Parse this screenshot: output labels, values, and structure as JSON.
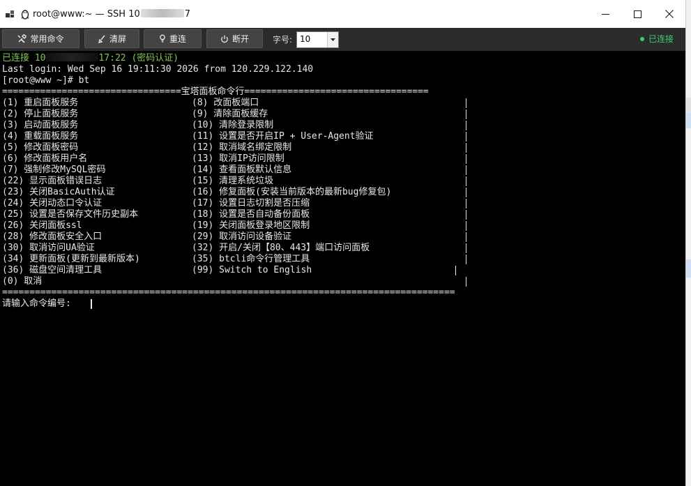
{
  "window": {
    "title_prefix": "root@www:~ — SSH 10",
    "title_suffix": "7",
    "minimize_glyph": "—",
    "maximize_glyph": "☐",
    "close_glyph": "✕"
  },
  "toolbar": {
    "buttons": [
      {
        "label": "常用命令",
        "icon": "tools-icon"
      },
      {
        "label": "清屏",
        "icon": "broom-icon"
      },
      {
        "label": "重连",
        "icon": "bulb-icon"
      },
      {
        "label": "断开",
        "icon": "power-icon"
      }
    ],
    "font_size_label": "字号:",
    "font_size_value": "10",
    "status": "已连接"
  },
  "colors": {
    "accent_green": "#3ccf6e",
    "terminal_green": "#80c850",
    "terminal_bg": "#000000",
    "terminal_fg": "#e8e8e8",
    "toolbar_bg": "#2b2b2b"
  },
  "terminal": {
    "connect_prefix": "已连接 10",
    "connect_suffix": "17:22 (密码认证)",
    "last_login": "Last login: Wed Sep 16 19:11:30 2026 from 120.229.122.140",
    "prompt": "[root@www ~]# bt",
    "header": "=================================宝塔面板命令行==================================",
    "footer": "===================================================================================",
    "menu": [
      {
        "left": "(1) 重启面板服务",
        "right": "(8) 改面板端口"
      },
      {
        "left": "(2) 停止面板服务",
        "right": "(9) 清除面板缓存"
      },
      {
        "left": "(3) 启动面板服务",
        "right": "(10) 清除登录限制"
      },
      {
        "left": "(4) 重载面板服务",
        "right": "(11) 设置是否开启IP + User-Agent验证"
      },
      {
        "left": "(5) 修改面板密码",
        "right": "(12) 取消域名绑定限制"
      },
      {
        "left": "(6) 修改面板用户名",
        "right": "(13) 取消IP访问限制"
      },
      {
        "left": "(7) 强制修改MySQL密码",
        "right": "(14) 查看面板默认信息"
      },
      {
        "left": "(22) 显示面板错误日志",
        "right": "(15) 清理系统垃圾"
      },
      {
        "left": "(23) 关闭BasicAuth认证",
        "right": "(16) 修复面板(安装当前版本的最新bug修复包)"
      },
      {
        "left": "(24) 关闭动态口令认证",
        "right": "(17) 设置日志切割是否压缩"
      },
      {
        "left": "(25) 设置是否保存文件历史副本",
        "right": "(18) 设置是否自动备份面板"
      },
      {
        "left": "(26) 关闭面板ssl",
        "right": "(19) 关闭面板登录地区限制"
      },
      {
        "left": "(28) 修改面板安全入口",
        "right": "(29) 取消访问设备验证"
      },
      {
        "left": "(30) 取消访问UA验证",
        "right": "(32) 开启/关闭【80、443】端口访问面板"
      },
      {
        "left": "(34) 更新面板(更新到最新版本)",
        "right": "(35) btcli命令行管理工具"
      },
      {
        "left": "(36) 磁盘空间清理工具",
        "right": "(99) Switch to English"
      },
      {
        "left": "(0) 取消",
        "right": ""
      }
    ],
    "input_prompt": "请输入命令编号:"
  }
}
